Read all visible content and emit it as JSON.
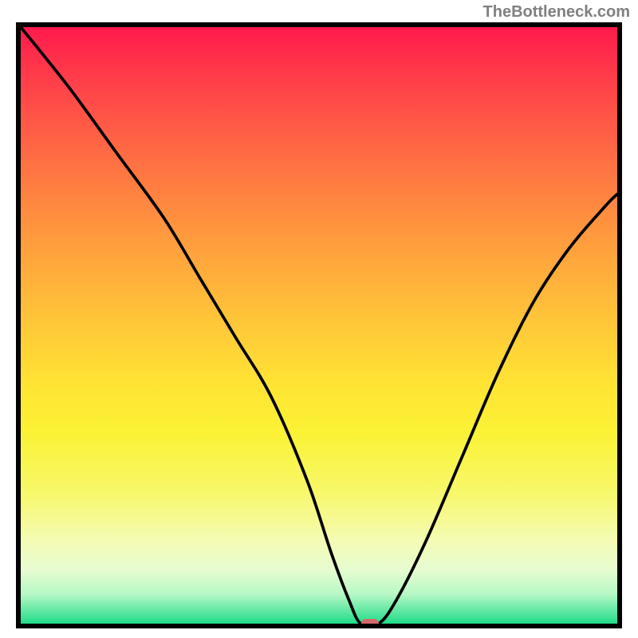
{
  "watermark": "TheBottleneck.com",
  "chart_data": {
    "type": "line",
    "title": "",
    "xlabel": "",
    "ylabel": "",
    "xlim": [
      0,
      100
    ],
    "ylim": [
      0,
      100
    ],
    "series": [
      {
        "name": "curve",
        "x": [
          0,
          8,
          16,
          24,
          30,
          36,
          42,
          48,
          52,
          55,
          57,
          60,
          63,
          68,
          74,
          80,
          86,
          92,
          98,
          100
        ],
        "y": [
          100,
          90,
          79,
          68,
          58,
          48,
          38,
          24,
          12,
          4,
          0,
          0,
          4,
          14,
          28,
          42,
          54,
          63,
          70,
          72
        ]
      }
    ],
    "marker": {
      "x": 58.5,
      "y": 0
    },
    "gradient_colors": {
      "top": "#ff1a4c",
      "mid_upper": "#ff9d3d",
      "mid": "#ffe434",
      "mid_lower": "#f4fbb4",
      "bottom": "#1fdc8a"
    }
  }
}
